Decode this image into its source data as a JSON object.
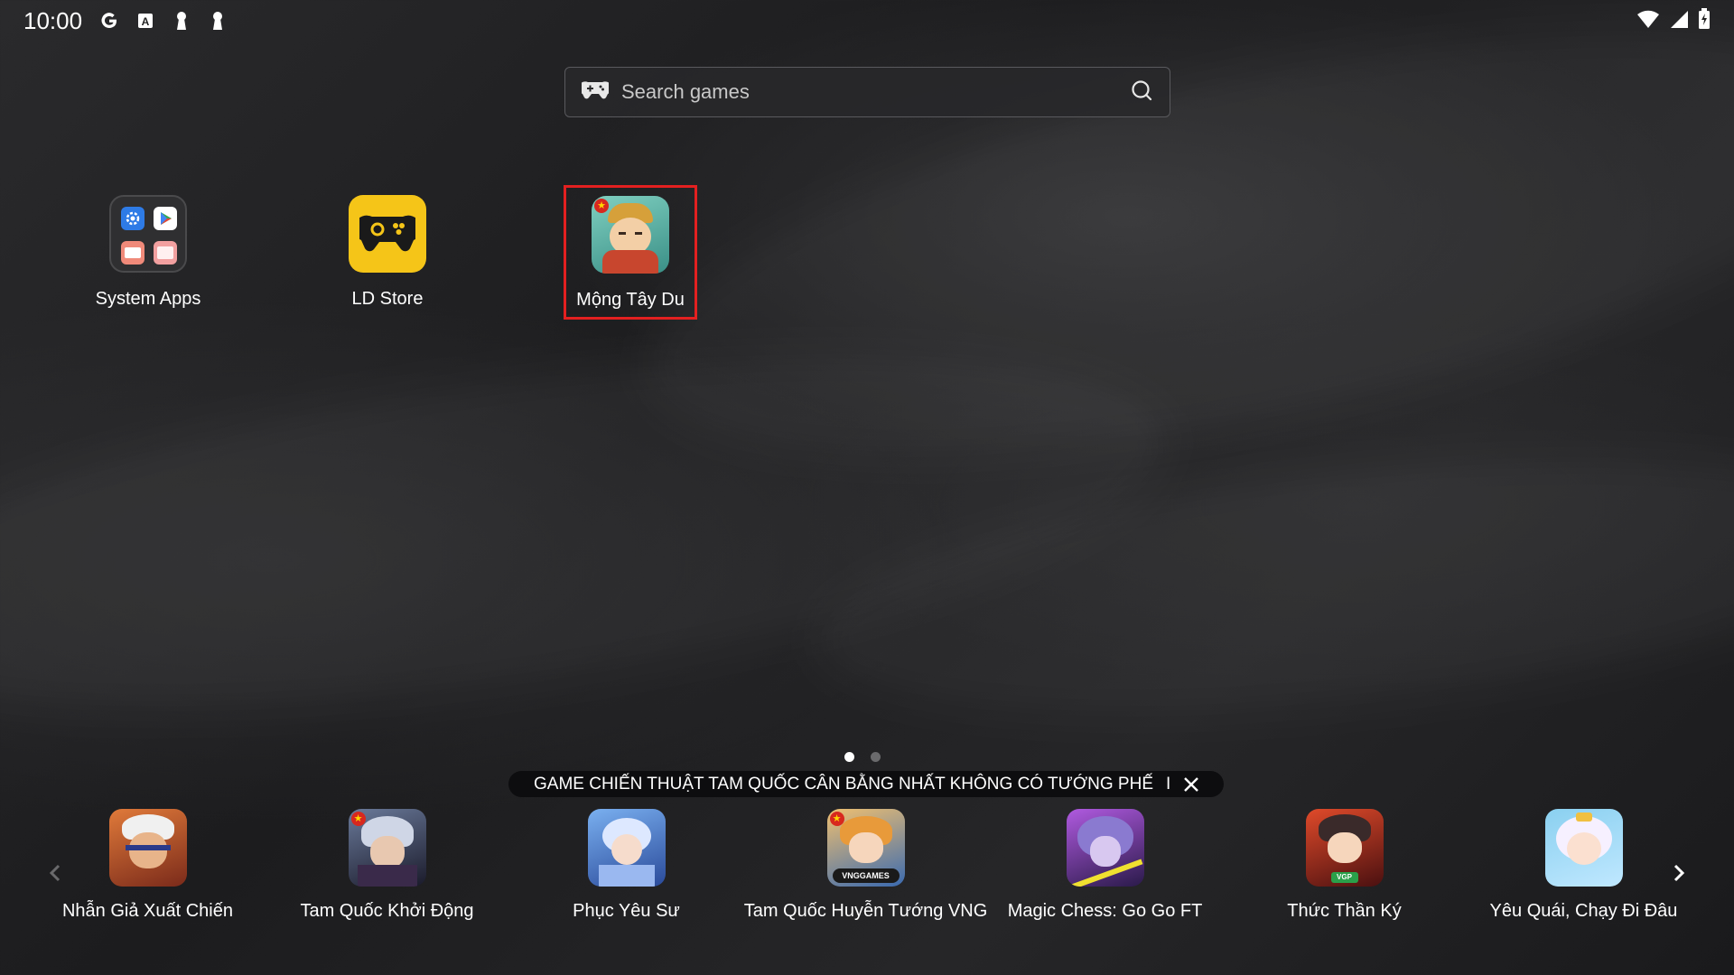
{
  "status_bar": {
    "time": "10:00",
    "left_icons": [
      "google-icon",
      "a-notification-icon",
      "keyhole-icon",
      "keyhole-icon"
    ],
    "right_icons": [
      "wifi-icon",
      "cell-signal-icon",
      "battery-icon"
    ]
  },
  "search": {
    "placeholder": "Search games",
    "icon": "gamepad-icon",
    "action_icon": "search-icon"
  },
  "desktop_apps": [
    {
      "label": "System Apps",
      "icon": "folder-icon"
    },
    {
      "label": "LD Store",
      "icon": "gamepad-icon",
      "color": "#f5c518"
    },
    {
      "label": "Mộng Tây Du",
      "icon": "game-character-icon",
      "highlighted": true,
      "highlight_color": "#e32020"
    }
  ],
  "pagination": {
    "pages": 2,
    "active": 0
  },
  "banner": {
    "text": "GAME CHIẾN THUẬT TAM QUỐC CÂN BẰNG NHẤT KHÔNG CÓ TƯỚNG PHẾ",
    "separator": "I"
  },
  "dock": {
    "items": [
      {
        "label": "Nhẫn Giả Xuất Chiến"
      },
      {
        "label": "Tam Quốc Khởi Động"
      },
      {
        "label": "Phục Yêu Sư"
      },
      {
        "label": "Tam Quốc Huyễn Tướng VNG",
        "badge_text": "VNGGAMES"
      },
      {
        "label": "Magic Chess: Go Go FT"
      },
      {
        "label": "Thức Thần Ký",
        "badge_text": "VGP"
      },
      {
        "label": "Yêu Quái, Chạy Đi Đâu"
      }
    ]
  }
}
